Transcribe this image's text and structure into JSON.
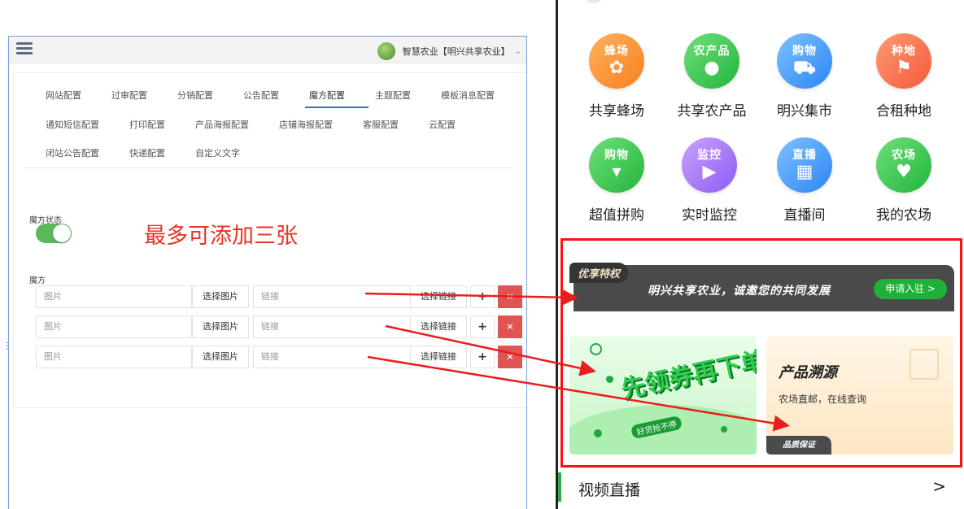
{
  "admin": {
    "user_label": "智慧农业【明兴共享农业】",
    "tabs": [
      "网站配置",
      "过审配置",
      "分销配置",
      "公告配置",
      "魔方配置",
      "主题配置",
      "模板消息配置",
      "通知短信配置",
      "打印配置",
      "产品海报配置",
      "店铺海报配置",
      "客服配置",
      "云配置",
      "闭站公告配置",
      "快递配置",
      "自定义文字"
    ],
    "active_tab": "魔方配置",
    "status_label": "魔方状态",
    "toggle_on": true,
    "note": "最多可添加三张",
    "cube_label": "魔方",
    "rows": [
      {
        "image_placeholder": "图片",
        "choose_image": "选择图片",
        "link_placeholder": "链接",
        "choose_link": "选择链接",
        "add": "+",
        "remove": "×"
      },
      {
        "image_placeholder": "图片",
        "choose_image": "选择图片",
        "link_placeholder": "链接",
        "choose_link": "选择链接",
        "add": "+",
        "remove": "×"
      },
      {
        "image_placeholder": "图片",
        "choose_image": "选择图片",
        "link_placeholder": "链接",
        "choose_link": "选择链接",
        "add": "+",
        "remove": "×"
      }
    ]
  },
  "phone": {
    "grid": [
      {
        "badge": "蜂场",
        "label": "共享蜂场",
        "color": "orange",
        "icon": "bee-icon"
      },
      {
        "badge": "农产品",
        "label": "共享农产品",
        "color": "green",
        "icon": "apple-icon"
      },
      {
        "badge": "购物",
        "label": "明兴集市",
        "color": "blue",
        "icon": "cart-icon"
      },
      {
        "badge": "种地",
        "label": "合租种地",
        "color": "red",
        "icon": "flag-icon"
      },
      {
        "badge": "购物",
        "label": "超值拼购",
        "color": "green",
        "icon": "basket-icon"
      },
      {
        "badge": "监控",
        "label": "实时监控",
        "color": "purple",
        "icon": "camera-icon"
      },
      {
        "badge": "直播",
        "label": "直播间",
        "color": "blue",
        "icon": "radio-icon"
      },
      {
        "badge": "农场",
        "label": "我的农场",
        "color": "green",
        "icon": "heart-icon"
      }
    ],
    "banner": {
      "tag": "优享特权",
      "text": "明兴共享农业，诚邀您的共同发展",
      "button": "申请入驻 >"
    },
    "card_left": {
      "title": "先领券再下单",
      "sub": "好货抢不停"
    },
    "card_right": {
      "title": "产品溯源",
      "sub": "农场直邮，在线查询",
      "badge": "品质保证"
    },
    "section_title": "视频直播",
    "section_chevron": ">"
  },
  "colors": {
    "accent_red": "#ea3323",
    "toggle_green": "#5cb85c",
    "delete_red": "#e05454",
    "brand_green": "#20b03a"
  }
}
